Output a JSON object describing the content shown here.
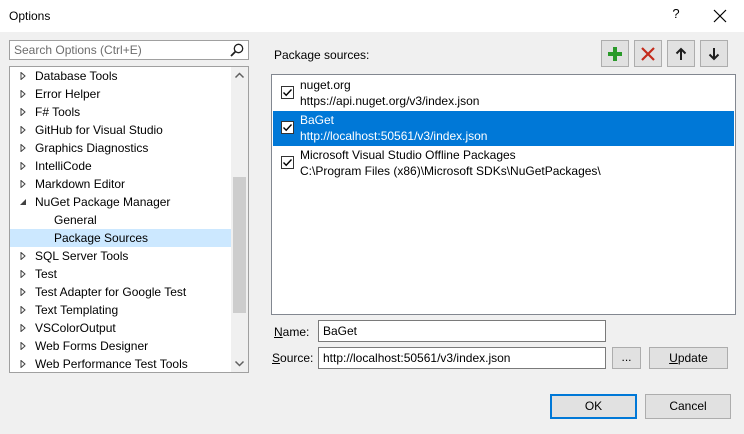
{
  "window": {
    "title": "Options",
    "help_label": "?",
    "close_label": "✕"
  },
  "search": {
    "placeholder": "Search Options (Ctrl+E)"
  },
  "tree": {
    "items": [
      {
        "label": "Database Tools",
        "indent": 0,
        "expander": "collapsed"
      },
      {
        "label": "Error Helper",
        "indent": 0,
        "expander": "collapsed"
      },
      {
        "label": "F# Tools",
        "indent": 0,
        "expander": "collapsed"
      },
      {
        "label": "GitHub for Visual Studio",
        "indent": 0,
        "expander": "collapsed"
      },
      {
        "label": "Graphics Diagnostics",
        "indent": 0,
        "expander": "collapsed"
      },
      {
        "label": "IntelliCode",
        "indent": 0,
        "expander": "collapsed"
      },
      {
        "label": "Markdown Editor",
        "indent": 0,
        "expander": "collapsed"
      },
      {
        "label": "NuGet Package Manager",
        "indent": 0,
        "expander": "expanded"
      },
      {
        "label": "General",
        "indent": 1,
        "expander": "none"
      },
      {
        "label": "Package Sources",
        "indent": 1,
        "expander": "none",
        "selected": true
      },
      {
        "label": "SQL Server Tools",
        "indent": 0,
        "expander": "collapsed"
      },
      {
        "label": "Test",
        "indent": 0,
        "expander": "collapsed"
      },
      {
        "label": "Test Adapter for Google Test",
        "indent": 0,
        "expander": "collapsed"
      },
      {
        "label": "Text Templating",
        "indent": 0,
        "expander": "collapsed"
      },
      {
        "label": "VSColorOutput",
        "indent": 0,
        "expander": "collapsed"
      },
      {
        "label": "Web Forms Designer",
        "indent": 0,
        "expander": "collapsed"
      },
      {
        "label": "Web Performance Test Tools",
        "indent": 0,
        "expander": "collapsed"
      }
    ]
  },
  "package_sources": {
    "label": "Package sources:",
    "toolbar": {
      "add_icon": "plus-icon",
      "remove_icon": "x-icon",
      "up_icon": "arrow-up-icon",
      "down_icon": "arrow-down-icon"
    },
    "items": [
      {
        "name": "nuget.org",
        "url": "https://api.nuget.org/v3/index.json",
        "checked": true,
        "selected": false
      },
      {
        "name": "BaGet",
        "url": "http://localhost:50561/v3/index.json",
        "checked": true,
        "selected": true
      },
      {
        "name": "Microsoft Visual Studio Offline Packages",
        "url": "C:\\Program Files (x86)\\Microsoft SDKs\\NuGetPackages\\",
        "checked": true,
        "selected": false
      }
    ]
  },
  "form": {
    "name_label_mnemonic": "N",
    "name_label_rest": "ame:",
    "name_value": "BaGet",
    "source_label_mnemonic": "S",
    "source_label_rest": "ource:",
    "source_value": "http://localhost:50561/v3/index.json",
    "browse_label": "...",
    "update_label_mnemonic": "U",
    "update_label_rest": "pdate"
  },
  "footer": {
    "ok_label": "OK",
    "cancel_label": "Cancel"
  },
  "colors": {
    "selection_blue": "#0078d7",
    "tree_selection": "#cce8ff",
    "add_green": "#2a9a2a",
    "remove_red": "#c42b1c"
  }
}
